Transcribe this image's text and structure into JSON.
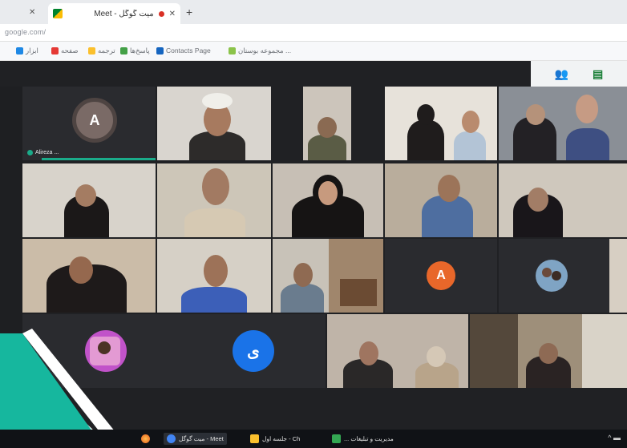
{
  "browser": {
    "tab_title": "میت گوگل - Meet",
    "url": "google.com/",
    "bookmarks": [
      {
        "label": "مجموعه بوستان ...",
        "color": "#8bc34a"
      },
      {
        "label": "Contacts Page",
        "color": "#1565c0"
      },
      {
        "label": "پاسخ‌ها",
        "color": "#43a047"
      },
      {
        "label": "ترجمه",
        "color": "#fbc02d"
      },
      {
        "label": "صفحه",
        "color": "#e53935"
      },
      {
        "label": "ابزار",
        "color": "#1e88e5"
      }
    ]
  },
  "meet": {
    "participants": [
      {
        "initial": "A",
        "name": "Alireza ..."
      },
      {
        "initial": "A",
        "name": ""
      },
      {
        "initial": "ی",
        "name": ""
      }
    ]
  },
  "taskbar": {
    "items": [
      {
        "label": "میت گوگل - Meet",
        "color": "#4285f4"
      },
      {
        "label": "جلسه اول - Ch",
        "color": "#fbc02d"
      },
      {
        "label": "... مدیریت و تبلیغات",
        "color": "#34a853"
      }
    ],
    "tray": "^ ▬"
  },
  "colors": {
    "accent": "#1aab8a",
    "avatar_orange": "#e8672a",
    "avatar_blue": "#1a73e8",
    "avatar_gray": "#5f6368"
  }
}
